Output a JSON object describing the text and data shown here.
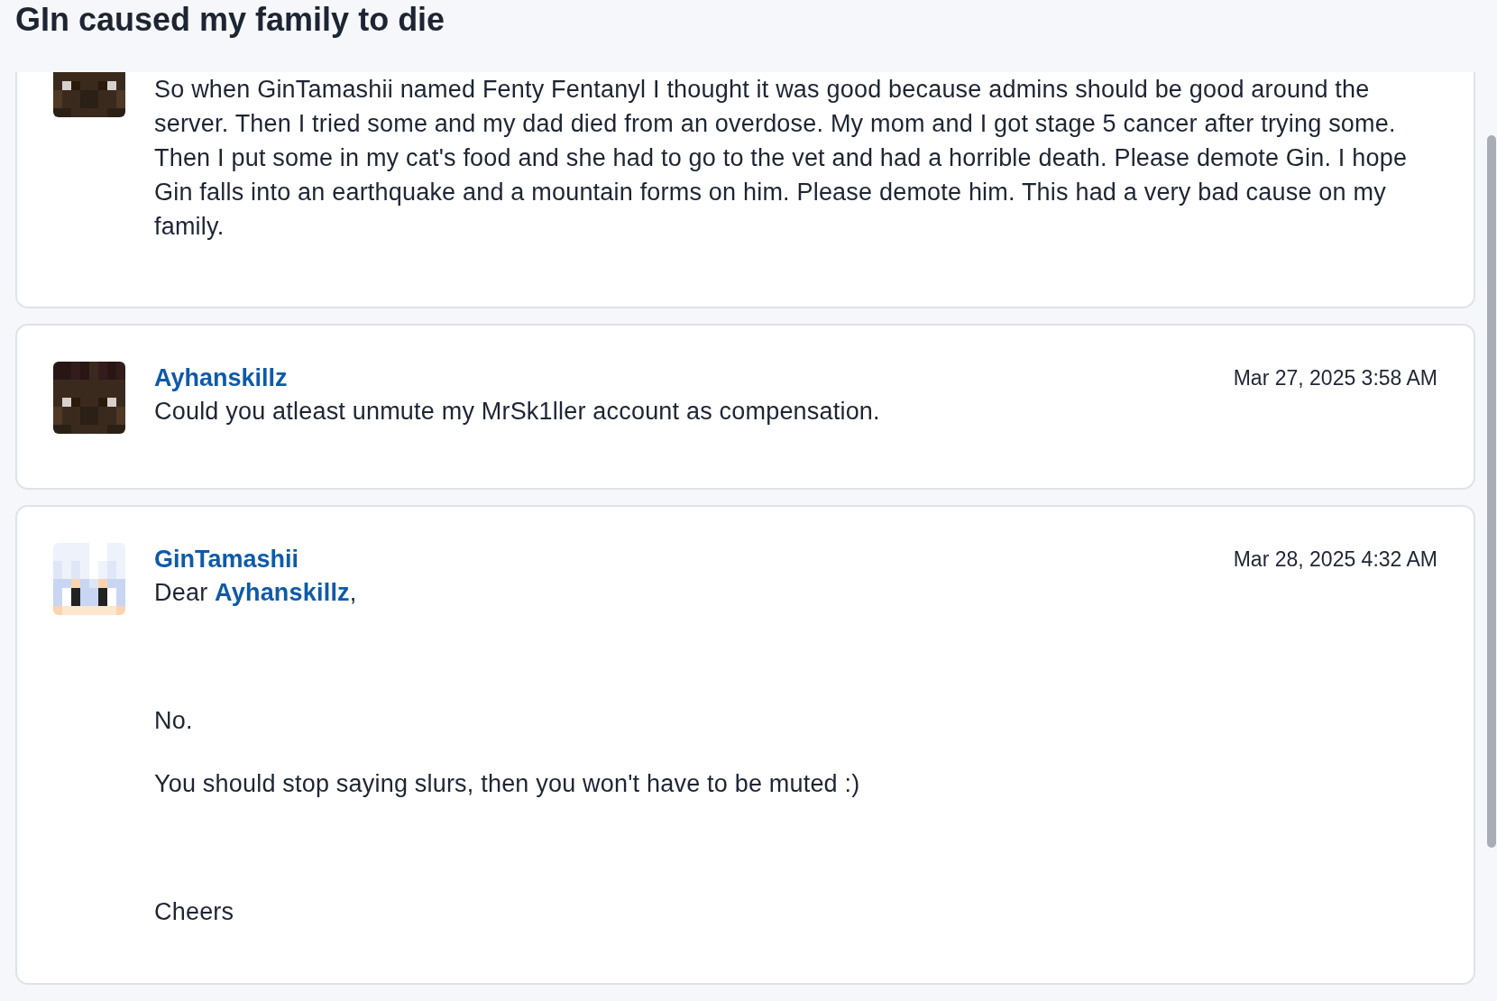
{
  "thread": {
    "title": "GIn caused my family to die"
  },
  "posts": [
    {
      "paragraphs": [
        {
          "kind": "text",
          "text": "So when GinTamashii named Fenty Fentanyl I thought it was good because admins should be good around the server. Then I tried some and my dad died from an overdose. My mom and I got stage 5 cancer after trying some. Then I put some in my cat's food and she had to go to the vet and had a horrible death. Please demote Gin. I hope Gin falls into an earthquake and a mountain forms on him. Please demote him. This had a very bad cause on my family."
        }
      ]
    },
    {
      "author": "Ayhanskillz",
      "timestamp": "Mar 27, 2025 3:58 AM",
      "paragraphs": [
        {
          "kind": "text",
          "text": "Could you atleast unmute my MrSk1ller account as compensation."
        }
      ]
    },
    {
      "author": "GinTamashii",
      "timestamp": "Mar 28, 2025 4:32 AM",
      "paragraphs": [
        {
          "kind": "greeting",
          "before": "Dear ",
          "mention": "Ayhanskillz",
          "after": ","
        },
        {
          "kind": "text",
          "text": "No."
        },
        {
          "kind": "text",
          "text": "You should stop saying slurs, then you won't have to be muted :)"
        },
        {
          "kind": "signoff",
          "text": "Cheers"
        }
      ]
    }
  ]
}
